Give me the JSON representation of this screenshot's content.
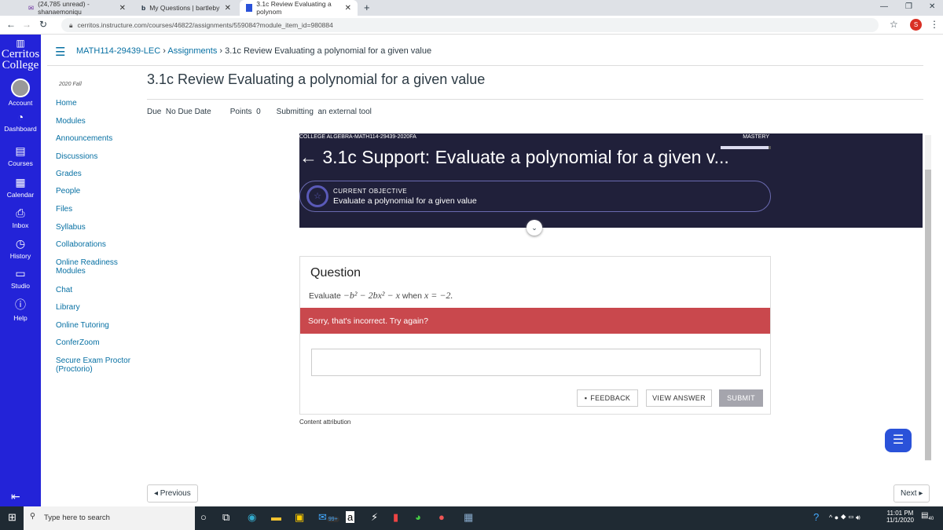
{
  "browser": {
    "tabs": [
      {
        "label": "(24,785 unread) - shanaemoniqu",
        "icon": "mail-icon"
      },
      {
        "label": "My Questions | bartleby",
        "icon": "bartleby-icon"
      },
      {
        "label": "3.1c Review Evaluating a polynom",
        "icon": "canvas-icon",
        "active": true
      }
    ],
    "url": "cerritos.instructure.com/courses/46822/assignments/559084?module_item_id=980884",
    "profile": "S"
  },
  "logo": {
    "text": "Cerritos College"
  },
  "global_nav": [
    {
      "label": "Account"
    },
    {
      "label": "Dashboard"
    },
    {
      "label": "Courses"
    },
    {
      "label": "Calendar"
    },
    {
      "label": "Inbox"
    },
    {
      "label": "History"
    },
    {
      "label": "Studio"
    },
    {
      "label": "Help"
    }
  ],
  "course_nav": {
    "term": "2020 Fall",
    "items": [
      "Home",
      "Modules",
      "Announcements",
      "Discussions",
      "Grades",
      "People",
      "Files",
      "Syllabus",
      "Collaborations",
      "Online Readiness Modules",
      "Chat",
      "Library",
      "Online Tutoring",
      "ConferZoom",
      "Secure Exam Proctor (Proctorio)"
    ]
  },
  "breadcrumb": {
    "course": "MATH114-29439-LEC",
    "section": "Assignments",
    "current": "3.1c Review Evaluating a polynomial for a given value"
  },
  "page": {
    "title": "3.1c Review Evaluating a polynomial for a given value",
    "due_label": "Due",
    "due_value": "No Due Date",
    "points_label": "Points",
    "points_value": "0",
    "submitting_label": "Submitting",
    "submitting_value": "an external tool"
  },
  "tool": {
    "course": "COLLEGE ALGEBRA-MATH114-29439-2020FA",
    "mastery_label": "MASTERY",
    "mastery_progress": 0.95,
    "title": "3.1c Support: Evaluate a polynomial for a given v...",
    "objective_label": "CURRENT OBJECTIVE",
    "objective": "Evaluate a polynomial for a given value",
    "question_heading": "Question",
    "question_prefix": "Evaluate",
    "question_expr": "−b² − 2bx² − x",
    "question_when": "when",
    "question_cond": "x = −2.",
    "error": "Sorry, that's incorrect. Try again?",
    "answer_value": "",
    "feedback": "FEEDBACK",
    "view_answer": "VIEW ANSWER",
    "submit": "SUBMIT",
    "attribution": "Content attribution",
    "colors": {
      "header": "#20203a",
      "error": "#c9484d"
    }
  },
  "pager": {
    "previous": "◂ Previous",
    "next": "Next ▸"
  },
  "taskbar": {
    "search_placeholder": "Type here to search",
    "time": "11:01 PM",
    "date": "11/1/2020",
    "mail_badge": "99+",
    "notif_badge": "40"
  }
}
